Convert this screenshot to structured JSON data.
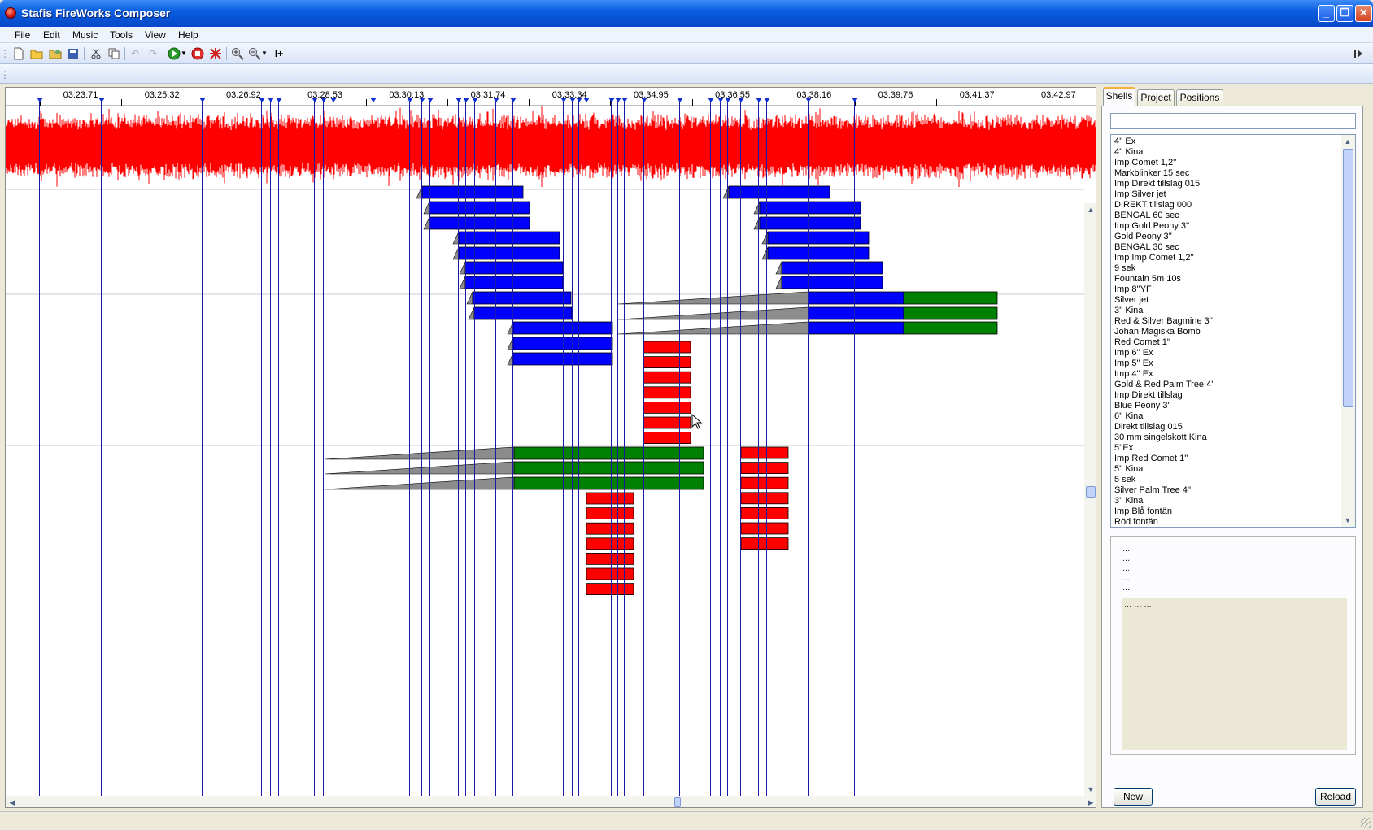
{
  "window": {
    "title": "Stafis FireWorks Composer",
    "minimize": "_",
    "maximize": "❐",
    "close": "✕"
  },
  "menu": [
    "File",
    "Edit",
    "Music",
    "Tools",
    "View",
    "Help"
  ],
  "toolbar": {
    "icons": [
      "new-file-icon",
      "open-folder-icon",
      "open-project-icon",
      "save-icon",
      "cut-icon",
      "copy-icon",
      "undo-icon",
      "redo-icon",
      "play-icon",
      "dropdown-icon",
      "stop-icon",
      "clear-icon",
      "zoom-in-icon",
      "zoom-out-icon",
      "dropdown-icon",
      "insert-icon"
    ],
    "insert_label": "I+"
  },
  "timeline": {
    "time_labels": [
      "03:23:71",
      "03:25:32",
      "03:26:92",
      "03:28:53",
      "03:30:13",
      "03:31:74",
      "03:33:34",
      "03:34:95",
      "03:36:55",
      "03:38:16",
      "03:39:76",
      "03:41:37",
      "03:42:97"
    ],
    "waveform_color": "#ff0000",
    "cue_color": "#1a1aa8",
    "colors": {
      "blue": "#0000ff",
      "green": "#008000",
      "red": "#ff0000",
      "ramp": "#8c8c8c"
    }
  },
  "right_panel": {
    "tabs": [
      "Shells",
      "Project",
      "Positions"
    ],
    "active_tab": "Shells",
    "search_value": "",
    "shells": [
      "4'' Ex",
      "4'' Kina",
      "Imp Comet 1,2''",
      "Markblinker 15 sec",
      "Imp Direkt tillslag 015",
      "Imp Silver jet",
      "DIREKT tillslag 000",
      "BENGAL 60 sec",
      "Imp Gold Peony 3''",
      "Gold Peony 3''",
      "BENGAL 30 sec",
      "Imp Imp Comet 1,2''",
      "9 sek",
      "Fountain 5m 10s",
      "Imp 8''YF",
      "Silver jet",
      "3'' Kina",
      "Red & Silver Bagmine 3''",
      "Johan Magiska Bomb",
      "Red Comet 1''",
      "Imp 6'' Ex",
      "Imp 5'' Ex",
      "Imp 4'' Ex",
      "Gold & Red Palm Tree 4''",
      "Imp Direkt tillslag",
      "Blue Peony 3''",
      "6'' Kina",
      "Direkt tillslag 015",
      "30 mm singelskott Kina",
      "5''Ex",
      "Imp Red Comet 1''",
      "5'' Kina",
      "5 sek",
      "Silver Palm Tree 4''",
      "3'' Kina",
      "Imp Blå fontän",
      "Röd fontän"
    ],
    "info_lines": [
      "...",
      "...",
      "...",
      "...",
      "...",
      "..."
    ],
    "info_box_text": "... ... ...",
    "new_button": "New",
    "reload_button": "Reload"
  }
}
